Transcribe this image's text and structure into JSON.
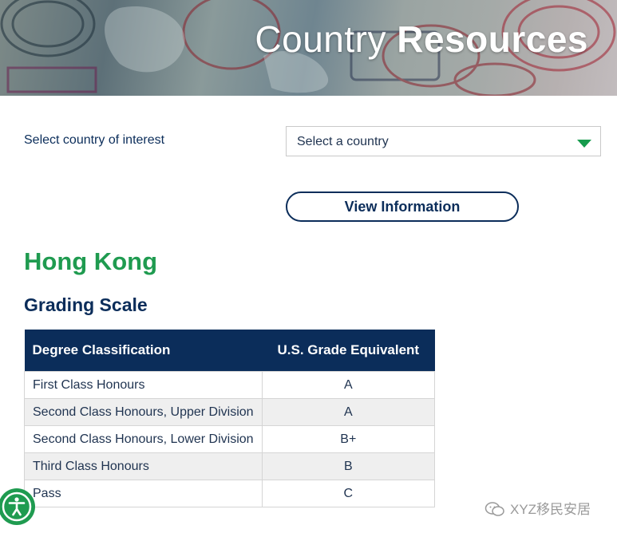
{
  "hero": {
    "title_light": "Country",
    "title_bold": "Resources"
  },
  "selector": {
    "label": "Select country of interest",
    "value": "Select a country",
    "button": "View Information"
  },
  "country": {
    "name": "Hong Kong",
    "section_title": "Grading Scale"
  },
  "grading_table": {
    "headers": [
      "Degree Classification",
      "U.S. Grade Equivalent"
    ],
    "rows": [
      {
        "degree": "First Class Honours",
        "grade": "A"
      },
      {
        "degree": "Second Class Honours, Upper Division",
        "grade": "A"
      },
      {
        "degree": "Second Class Honours, Lower Division",
        "grade": "B+"
      },
      {
        "degree": "Third Class Honours",
        "grade": "B"
      },
      {
        "degree": "Pass",
        "grade": "C"
      }
    ]
  },
  "watermark": {
    "text": "XYZ移民安居"
  },
  "colors": {
    "navy": "#0b2d5a",
    "green": "#1f9b50",
    "row_alt": "#efefef"
  },
  "icons": [
    "accessibility-icon",
    "dropdown-caret-icon",
    "wechat-icon"
  ]
}
